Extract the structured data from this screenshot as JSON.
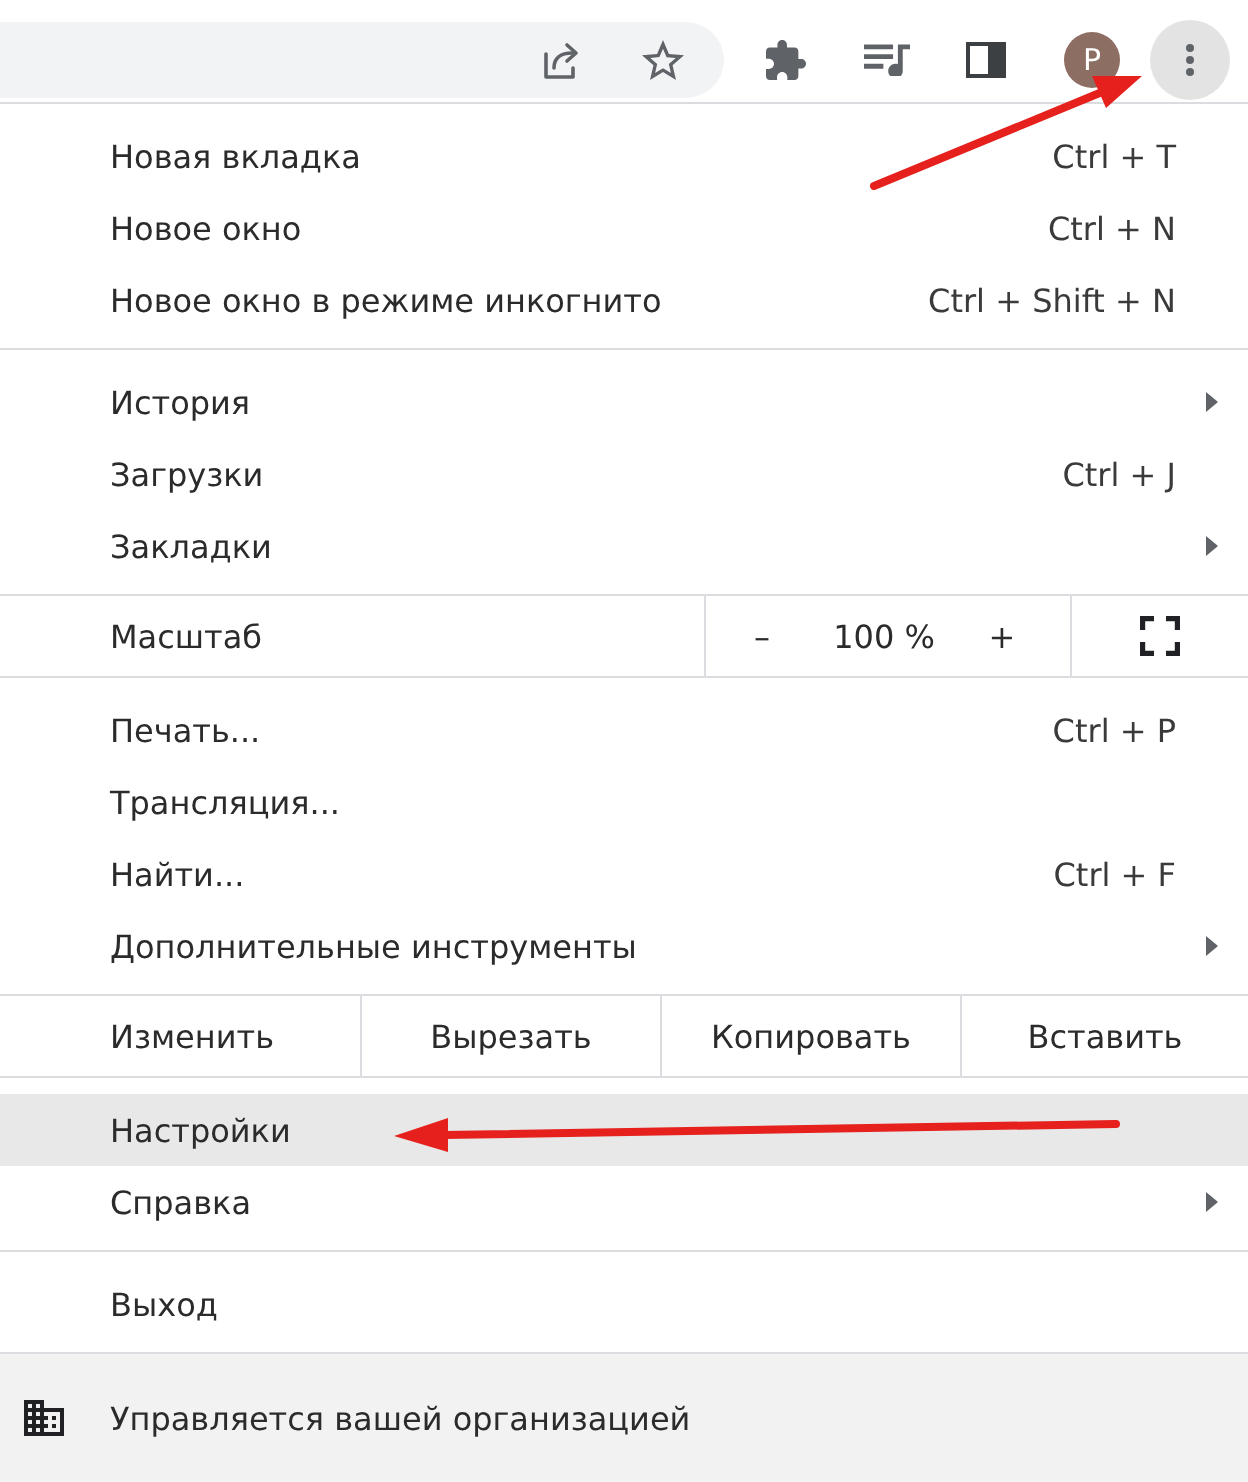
{
  "toolbar": {
    "bookmarked": false,
    "avatar": "P",
    "menu_open": true
  },
  "menu": {
    "sections": [
      {
        "items": [
          {
            "kind": "command",
            "label": "Новая вкладка",
            "shortcut": "Ctrl + T",
            "submenu": false,
            "highlighted": false
          },
          {
            "kind": "command",
            "label": "Новое окно",
            "shortcut": "Ctrl + N",
            "submenu": false,
            "highlighted": false
          },
          {
            "kind": "command",
            "label": "Новое окно в режиме инкогнито",
            "shortcut": "Ctrl + Shift + N",
            "submenu": false,
            "highlighted": false
          }
        ]
      },
      {
        "items": [
          {
            "kind": "command",
            "label": "История",
            "submenu": true,
            "highlighted": false
          },
          {
            "kind": "command",
            "label": "Загрузки",
            "shortcut": "Ctrl + J",
            "submenu": false,
            "highlighted": false
          },
          {
            "kind": "command",
            "label": "Закладки",
            "submenu": true,
            "highlighted": false
          }
        ]
      },
      {
        "items": [
          {
            "kind": "zoom",
            "label": "Масштаб",
            "decrease": "–",
            "value": "100 %",
            "increase": "+"
          }
        ]
      },
      {
        "items": [
          {
            "kind": "command",
            "label": "Печать...",
            "shortcut": "Ctrl + P",
            "submenu": false,
            "highlighted": false
          },
          {
            "kind": "command",
            "label": "Трансляция...",
            "submenu": false,
            "highlighted": false
          },
          {
            "kind": "command",
            "label": "Найти...",
            "shortcut": "Ctrl + F",
            "submenu": false,
            "highlighted": false
          },
          {
            "kind": "command",
            "label": "Дополнительные инструменты",
            "submenu": true,
            "highlighted": false
          }
        ]
      },
      {
        "items": [
          {
            "kind": "edit",
            "label": "Изменить",
            "actions": [
              "Вырезать",
              "Копировать",
              "Вставить"
            ]
          }
        ]
      },
      {
        "items": [
          {
            "kind": "command",
            "label": "Настройки",
            "submenu": false,
            "highlighted": true
          },
          {
            "kind": "command",
            "label": "Справка",
            "submenu": true,
            "highlighted": false
          }
        ]
      },
      {
        "items": [
          {
            "kind": "command",
            "label": "Выход",
            "submenu": false,
            "highlighted": false
          }
        ]
      }
    ],
    "managed_note": "Управляется вашей организацией"
  }
}
